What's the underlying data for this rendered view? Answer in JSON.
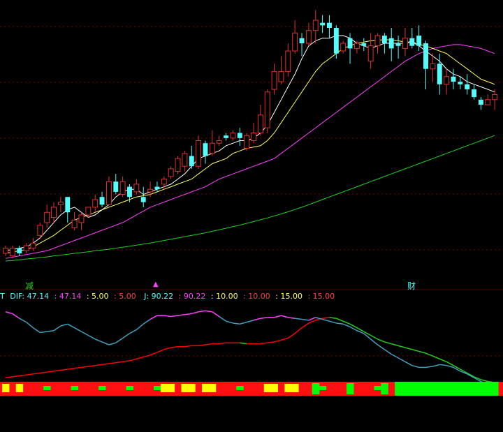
{
  "markers": {
    "left_label": "减",
    "mid_label": "▲",
    "right_label": "财"
  },
  "indicator_bar": {
    "t_label": "T",
    "dif_label": "DIF: 47.14",
    "v2": ": 47.14",
    "v3": ": 5.00",
    "v4": ": 5.00",
    "j_label": "J: 90.22",
    "v6": ": 90.22",
    "v7": ": 10.00",
    "v8": ": 10.00",
    "v9": ": 15.00",
    "v10": ": 15.00"
  },
  "colors": {
    "up": "#e0302f",
    "down": "#54fcfc",
    "ma_white": "#ffffff",
    "ma_yellow": "#ffff60",
    "ma_magenta": "#ff40ff",
    "ma_green": "#20d020",
    "dif": "#ff0000",
    "grid": "#800000"
  },
  "chart_data": [
    {
      "type": "candlestick",
      "title": "",
      "ylim": [
        0,
        100
      ],
      "candles": [
        [
          6,
          8,
          5,
          9
        ],
        [
          5,
          8,
          4,
          9
        ],
        [
          8,
          6,
          5,
          9
        ],
        [
          7,
          9,
          6,
          10
        ],
        [
          8,
          10,
          7,
          12
        ],
        [
          13,
          17,
          12,
          18
        ],
        [
          18,
          22,
          16,
          25
        ],
        [
          20,
          24,
          18,
          26
        ],
        [
          25,
          26,
          22,
          28
        ],
        [
          28,
          22,
          18,
          28
        ],
        [
          16,
          19,
          15,
          22
        ],
        [
          18,
          21,
          15,
          22
        ],
        [
          21,
          24,
          20,
          24
        ],
        [
          24,
          27,
          22,
          29
        ],
        [
          28,
          25,
          24,
          30
        ],
        [
          25,
          34,
          25,
          36
        ],
        [
          34,
          30,
          29,
          37
        ],
        [
          29,
          34,
          28,
          36
        ],
        [
          32,
          28,
          26,
          33
        ],
        [
          30,
          33,
          29,
          35
        ],
        [
          28,
          26,
          24,
          32
        ],
        [
          30,
          31,
          28,
          34
        ],
        [
          32,
          31,
          30,
          34
        ],
        [
          33,
          35,
          31,
          36
        ],
        [
          36,
          39,
          35,
          40
        ],
        [
          38,
          43,
          37,
          44
        ],
        [
          40,
          45,
          38,
          46
        ],
        [
          44,
          40,
          39,
          48
        ],
        [
          40,
          50,
          39,
          52
        ],
        [
          49,
          44,
          41,
          50
        ],
        [
          45,
          49,
          44,
          54
        ],
        [
          49,
          50,
          48,
          52
        ],
        [
          52,
          51,
          50,
          53
        ],
        [
          51,
          53,
          50,
          54
        ],
        [
          53,
          51,
          48,
          55
        ],
        [
          47,
          52,
          46,
          53
        ],
        [
          50,
          53,
          49,
          57
        ],
        [
          53,
          60,
          52,
          64
        ],
        [
          55,
          69,
          53,
          70
        ],
        [
          70,
          77,
          68,
          80
        ],
        [
          73,
          77,
          72,
          83
        ],
        [
          77,
          85,
          75,
          88
        ],
        [
          85,
          92,
          84,
          97
        ],
        [
          90,
          88,
          83,
          92
        ],
        [
          88,
          93,
          87,
          96
        ],
        [
          93,
          97,
          88,
          101
        ],
        [
          96,
          95,
          92,
          99
        ],
        [
          96,
          94,
          90,
          99
        ],
        [
          94,
          84,
          82,
          95
        ],
        [
          85,
          88,
          84,
          89
        ],
        [
          90,
          86,
          80,
          92
        ],
        [
          86,
          88,
          84,
          89
        ],
        [
          88,
          87,
          85,
          90
        ],
        [
          81,
          87,
          78,
          92
        ],
        [
          87,
          91,
          84,
          92
        ],
        [
          91,
          88,
          84,
          92
        ],
        [
          90,
          86,
          81,
          94
        ],
        [
          88,
          87,
          82,
          91
        ],
        [
          86,
          90,
          83,
          94
        ],
        [
          90,
          87,
          86,
          94
        ],
        [
          91,
          87,
          85,
          95
        ],
        [
          88,
          78,
          70,
          89
        ],
        [
          78,
          80,
          73,
          84
        ],
        [
          80,
          72,
          68,
          84
        ],
        [
          72,
          75,
          68,
          78
        ],
        [
          75,
          73,
          70,
          78
        ],
        [
          73,
          72,
          70,
          75
        ],
        [
          72,
          70,
          68,
          76
        ],
        [
          70,
          67,
          66,
          72
        ],
        [
          66,
          64,
          62,
          67
        ],
        [
          64,
          66,
          64,
          68
        ],
        [
          66,
          68,
          62,
          70
        ]
      ],
      "ma5": [
        7,
        7.5,
        8,
        8.5,
        10,
        12,
        15,
        18,
        21,
        23,
        24,
        22,
        20,
        21,
        23,
        25,
        28,
        30,
        31,
        31,
        29,
        30,
        31,
        32,
        33,
        35,
        37,
        40,
        43,
        44,
        45,
        46,
        48,
        49,
        50,
        50,
        51,
        53,
        56,
        61,
        66,
        71,
        76,
        82,
        87,
        89,
        90,
        90,
        91,
        91,
        90,
        88,
        87,
        86,
        87,
        88,
        88,
        88,
        88,
        89,
        87,
        85,
        83,
        81,
        78,
        76,
        75,
        73,
        72,
        71,
        70,
        69
      ],
      "ma10": [
        6,
        6.5,
        7,
        7.5,
        8.5,
        10,
        11.5,
        13,
        15,
        17,
        19,
        20,
        21,
        22,
        23,
        24,
        25,
        26,
        27,
        28,
        28.5,
        29,
        30,
        31,
        32,
        33,
        34,
        35,
        37,
        39,
        41,
        42,
        43,
        45,
        46,
        47,
        47.5,
        48,
        50,
        53,
        57,
        61,
        65,
        69,
        73,
        77,
        80,
        82,
        84,
        86,
        87,
        88,
        88.5,
        89,
        89.2,
        89.4,
        89.3,
        89,
        88.5,
        88,
        87.5,
        87,
        86,
        85,
        84,
        82,
        80,
        78,
        76,
        74,
        73,
        72
      ],
      "ma20": [
        4,
        4.5,
        5,
        5.5,
        6,
        6.5,
        7,
        8,
        9,
        10,
        11,
        12,
        13,
        14,
        15,
        16,
        17,
        18,
        19.5,
        21,
        22.5,
        24,
        25,
        26,
        27,
        28,
        29,
        30,
        31,
        32,
        33.5,
        35,
        36,
        37,
        38,
        39,
        40,
        41,
        42,
        43,
        45,
        47,
        49,
        51,
        53,
        55,
        57,
        59,
        61,
        63,
        65,
        67,
        69,
        71,
        73,
        75,
        77,
        79,
        81,
        82.5,
        84,
        85,
        86,
        86.5,
        87,
        87.5,
        87.5,
        87,
        86.5,
        86,
        85,
        84
      ],
      "ma60": [
        3,
        3.2,
        3.5,
        3.8,
        4,
        4.3,
        4.6,
        5,
        5.3,
        5.6,
        6,
        6.3,
        6.6,
        7,
        7.3,
        7.6,
        8,
        8.4,
        8.8,
        9.2,
        9.6,
        10,
        10.5,
        11,
        11.5,
        12,
        12.5,
        13,
        13.5,
        14,
        14.6,
        15.2,
        15.8,
        16.4,
        17,
        17.7,
        18.4,
        19.1,
        19.8,
        20.6,
        21.4,
        22.2,
        23.1,
        24,
        25,
        26,
        27,
        28,
        29,
        30,
        31,
        32,
        33,
        34,
        35,
        36,
        37,
        38,
        39,
        40,
        41,
        42,
        43,
        44,
        45,
        46,
        47,
        48,
        49,
        50,
        51,
        52
      ]
    },
    {
      "type": "line",
      "title": "",
      "ylim": [
        0,
        100
      ],
      "series": [
        {
          "name": "DIF",
          "values": [
            25,
            26,
            27,
            28,
            29,
            30,
            31,
            32,
            33,
            34,
            35,
            36,
            37,
            38,
            39,
            40,
            41,
            42,
            43,
            45,
            47,
            49,
            52,
            55,
            57,
            58,
            58,
            59,
            59,
            60,
            61,
            61,
            62,
            62,
            62,
            61,
            61,
            61,
            62,
            63,
            65,
            67,
            72,
            78,
            83,
            86,
            88,
            89,
            88,
            85,
            82,
            78,
            74,
            70,
            66,
            63,
            61,
            59,
            57,
            55,
            53,
            51,
            48,
            45,
            42,
            38,
            34,
            30,
            26,
            23,
            21,
            20
          ]
        },
        {
          "name": "J",
          "values": [
            95,
            93,
            88,
            84,
            78,
            73,
            74,
            75,
            80,
            82,
            78,
            74,
            70,
            66,
            63,
            60,
            62,
            67,
            72,
            76,
            82,
            87,
            91,
            91,
            90,
            91,
            92,
            93,
            95,
            96,
            95,
            90,
            85,
            83,
            82,
            84,
            86,
            88,
            89,
            89,
            91,
            89,
            88,
            87,
            86,
            89,
            87,
            85,
            83,
            82,
            79,
            75,
            72,
            66,
            60,
            55,
            50,
            46,
            42,
            38,
            36,
            36,
            37,
            39,
            38,
            36,
            32,
            29,
            25,
            21,
            18,
            16
          ]
        }
      ]
    }
  ]
}
